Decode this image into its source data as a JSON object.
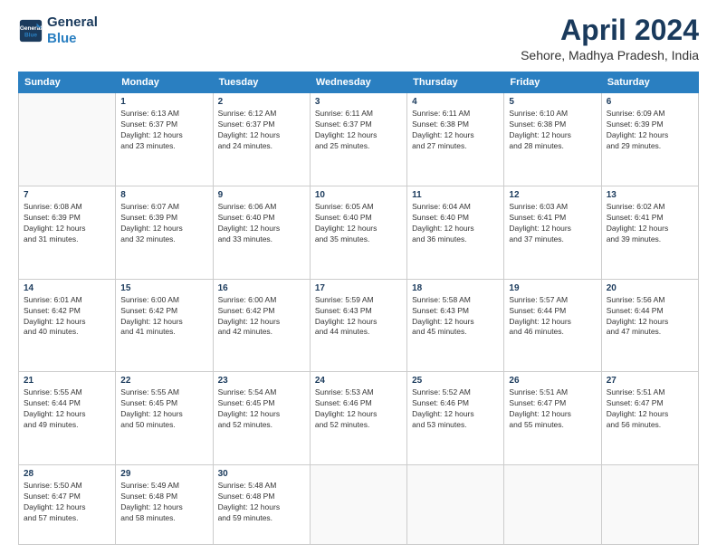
{
  "header": {
    "logo_line1": "General",
    "logo_line2": "Blue",
    "title": "April 2024",
    "subtitle": "Sehore, Madhya Pradesh, India"
  },
  "days_of_week": [
    "Sunday",
    "Monday",
    "Tuesday",
    "Wednesday",
    "Thursday",
    "Friday",
    "Saturday"
  ],
  "weeks": [
    [
      {
        "day": "",
        "info": ""
      },
      {
        "day": "1",
        "info": "Sunrise: 6:13 AM\nSunset: 6:37 PM\nDaylight: 12 hours\nand 23 minutes."
      },
      {
        "day": "2",
        "info": "Sunrise: 6:12 AM\nSunset: 6:37 PM\nDaylight: 12 hours\nand 24 minutes."
      },
      {
        "day": "3",
        "info": "Sunrise: 6:11 AM\nSunset: 6:37 PM\nDaylight: 12 hours\nand 25 minutes."
      },
      {
        "day": "4",
        "info": "Sunrise: 6:11 AM\nSunset: 6:38 PM\nDaylight: 12 hours\nand 27 minutes."
      },
      {
        "day": "5",
        "info": "Sunrise: 6:10 AM\nSunset: 6:38 PM\nDaylight: 12 hours\nand 28 minutes."
      },
      {
        "day": "6",
        "info": "Sunrise: 6:09 AM\nSunset: 6:39 PM\nDaylight: 12 hours\nand 29 minutes."
      }
    ],
    [
      {
        "day": "7",
        "info": "Sunrise: 6:08 AM\nSunset: 6:39 PM\nDaylight: 12 hours\nand 31 minutes."
      },
      {
        "day": "8",
        "info": "Sunrise: 6:07 AM\nSunset: 6:39 PM\nDaylight: 12 hours\nand 32 minutes."
      },
      {
        "day": "9",
        "info": "Sunrise: 6:06 AM\nSunset: 6:40 PM\nDaylight: 12 hours\nand 33 minutes."
      },
      {
        "day": "10",
        "info": "Sunrise: 6:05 AM\nSunset: 6:40 PM\nDaylight: 12 hours\nand 35 minutes."
      },
      {
        "day": "11",
        "info": "Sunrise: 6:04 AM\nSunset: 6:40 PM\nDaylight: 12 hours\nand 36 minutes."
      },
      {
        "day": "12",
        "info": "Sunrise: 6:03 AM\nSunset: 6:41 PM\nDaylight: 12 hours\nand 37 minutes."
      },
      {
        "day": "13",
        "info": "Sunrise: 6:02 AM\nSunset: 6:41 PM\nDaylight: 12 hours\nand 39 minutes."
      }
    ],
    [
      {
        "day": "14",
        "info": "Sunrise: 6:01 AM\nSunset: 6:42 PM\nDaylight: 12 hours\nand 40 minutes."
      },
      {
        "day": "15",
        "info": "Sunrise: 6:00 AM\nSunset: 6:42 PM\nDaylight: 12 hours\nand 41 minutes."
      },
      {
        "day": "16",
        "info": "Sunrise: 6:00 AM\nSunset: 6:42 PM\nDaylight: 12 hours\nand 42 minutes."
      },
      {
        "day": "17",
        "info": "Sunrise: 5:59 AM\nSunset: 6:43 PM\nDaylight: 12 hours\nand 44 minutes."
      },
      {
        "day": "18",
        "info": "Sunrise: 5:58 AM\nSunset: 6:43 PM\nDaylight: 12 hours\nand 45 minutes."
      },
      {
        "day": "19",
        "info": "Sunrise: 5:57 AM\nSunset: 6:44 PM\nDaylight: 12 hours\nand 46 minutes."
      },
      {
        "day": "20",
        "info": "Sunrise: 5:56 AM\nSunset: 6:44 PM\nDaylight: 12 hours\nand 47 minutes."
      }
    ],
    [
      {
        "day": "21",
        "info": "Sunrise: 5:55 AM\nSunset: 6:44 PM\nDaylight: 12 hours\nand 49 minutes."
      },
      {
        "day": "22",
        "info": "Sunrise: 5:55 AM\nSunset: 6:45 PM\nDaylight: 12 hours\nand 50 minutes."
      },
      {
        "day": "23",
        "info": "Sunrise: 5:54 AM\nSunset: 6:45 PM\nDaylight: 12 hours\nand 52 minutes."
      },
      {
        "day": "24",
        "info": "Sunrise: 5:53 AM\nSunset: 6:46 PM\nDaylight: 12 hours\nand 52 minutes."
      },
      {
        "day": "25",
        "info": "Sunrise: 5:52 AM\nSunset: 6:46 PM\nDaylight: 12 hours\nand 53 minutes."
      },
      {
        "day": "26",
        "info": "Sunrise: 5:51 AM\nSunset: 6:47 PM\nDaylight: 12 hours\nand 55 minutes."
      },
      {
        "day": "27",
        "info": "Sunrise: 5:51 AM\nSunset: 6:47 PM\nDaylight: 12 hours\nand 56 minutes."
      }
    ],
    [
      {
        "day": "28",
        "info": "Sunrise: 5:50 AM\nSunset: 6:47 PM\nDaylight: 12 hours\nand 57 minutes."
      },
      {
        "day": "29",
        "info": "Sunrise: 5:49 AM\nSunset: 6:48 PM\nDaylight: 12 hours\nand 58 minutes."
      },
      {
        "day": "30",
        "info": "Sunrise: 5:48 AM\nSunset: 6:48 PM\nDaylight: 12 hours\nand 59 minutes."
      },
      {
        "day": "",
        "info": ""
      },
      {
        "day": "",
        "info": ""
      },
      {
        "day": "",
        "info": ""
      },
      {
        "day": "",
        "info": ""
      }
    ]
  ]
}
